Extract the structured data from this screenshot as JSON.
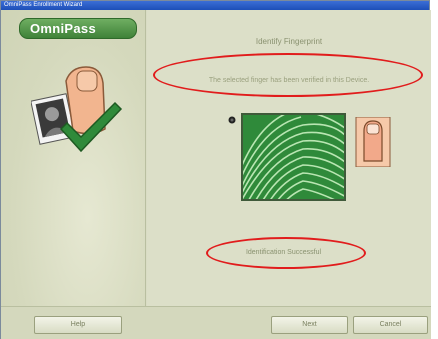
{
  "window": {
    "title": "OmniPass Enrollment Wizard"
  },
  "brand": {
    "logo_text": "OmniPass"
  },
  "step": {
    "heading": "Identify Fingerprint",
    "message": "The selected finger has been verified in this Device.",
    "result": "Identification Successful"
  },
  "buttons": {
    "help": "Help",
    "next": "Next",
    "cancel": "Cancel"
  },
  "colors": {
    "accent_green": "#3f8238",
    "fingerprint_bg": "#2f8a3a",
    "highlight_red": "#e11c1c"
  },
  "icons": {
    "hero": "hand-fingerprint-icon",
    "fingerprint": "fingerprint-scan",
    "finger": "finger-icon",
    "sensor": "sensor-icon"
  }
}
